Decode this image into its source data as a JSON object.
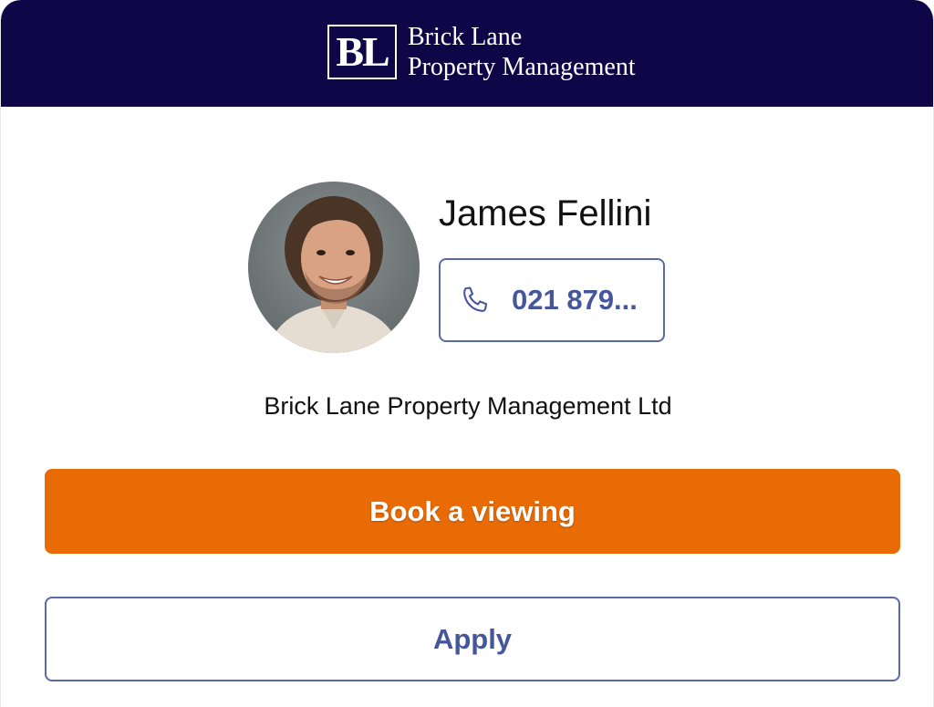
{
  "header": {
    "logo_mark": "BL",
    "brand_line1": "Brick Lane",
    "brand_line2": "Property Management",
    "background_color": "#0f0648"
  },
  "agent": {
    "name": "James Fellini",
    "phone_display": "021 879...",
    "phone_icon": "phone-icon",
    "company": "Brick Lane Property Management Ltd"
  },
  "actions": {
    "book_label": "Book a viewing",
    "book_color": "#e96b05",
    "apply_label": "Apply",
    "apply_color": "#46569a"
  }
}
